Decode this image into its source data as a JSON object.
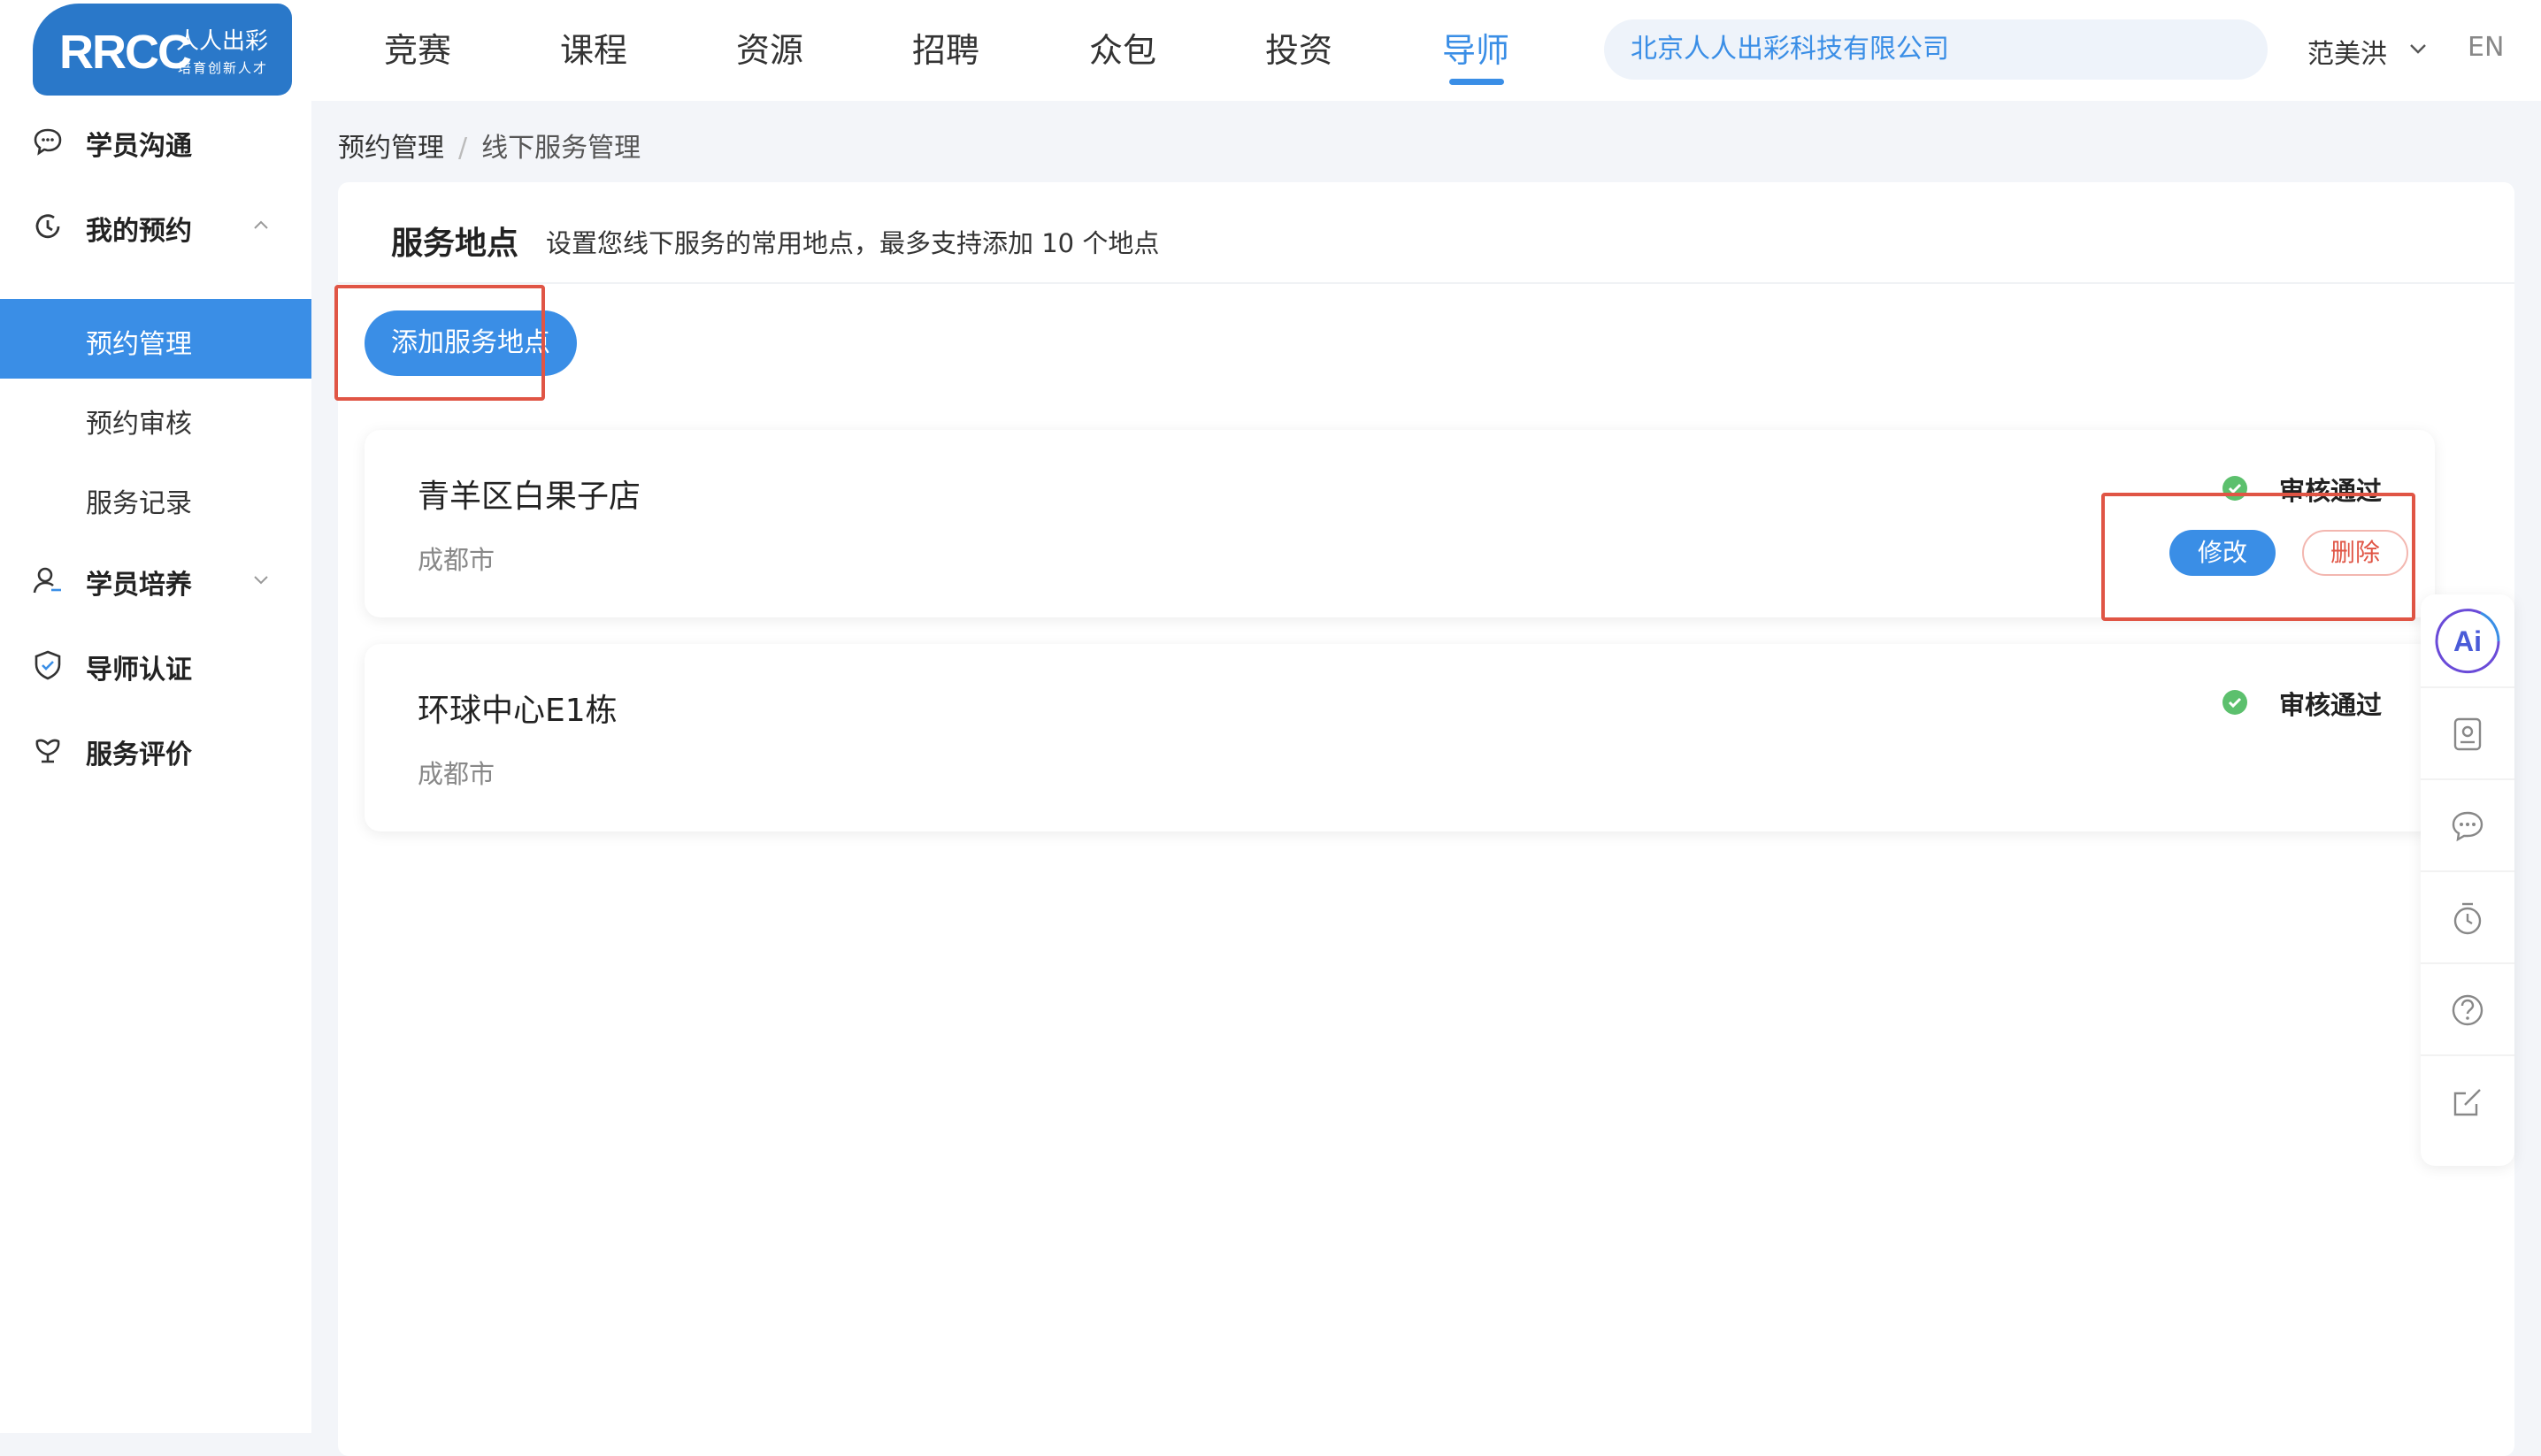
{
  "header": {
    "logo": {
      "main": "RRCC",
      "cn": "人人出彩",
      "sub": "培育创新人才"
    },
    "nav": [
      "竞赛",
      "课程",
      "资源",
      "招聘",
      "众包",
      "投资",
      "导师"
    ],
    "active_nav": "导师",
    "company": "北京人人出彩科技有限公司",
    "user_name": "范美洪",
    "lang": "EN"
  },
  "sidebar": {
    "items": [
      {
        "label": "学员沟通",
        "icon": "chat-icon"
      },
      {
        "label": "我的预约",
        "icon": "clock-icon",
        "expanded": true
      },
      {
        "label": "学员培养",
        "icon": "user-icon",
        "expanded": false
      },
      {
        "label": "导师认证",
        "icon": "shield-icon"
      },
      {
        "label": "服务评价",
        "icon": "flower-icon"
      }
    ],
    "sub_items": [
      "预约管理",
      "预约审核",
      "服务记录"
    ],
    "active_sub": "预约管理"
  },
  "breadcrumb": {
    "parent": "预约管理",
    "separator": "/",
    "current": "线下服务管理"
  },
  "panel": {
    "title": "服务地点",
    "description": "设置您线下服务的常用地点，最多支持添加 10 个地点",
    "add_button": "添加服务地点",
    "locations": [
      {
        "name": "青羊区白果子店",
        "city": "成都市",
        "status": "审核通过",
        "edit": "修改",
        "delete": "删除",
        "actions_visible": true
      },
      {
        "name": "环球中心E1栋",
        "city": "成都市",
        "status": "审核通过",
        "actions_visible": false
      }
    ]
  },
  "float_toolbar": {
    "items": [
      "ai-icon",
      "contact-card-icon",
      "message-icon",
      "timer-icon",
      "help-icon",
      "edit-icon"
    ],
    "ai_label": "Ai"
  },
  "colors": {
    "accent": "#3a8ee6",
    "status_ok": "#5cc06d",
    "danger": "#e05545",
    "highlight": "#e05545"
  }
}
